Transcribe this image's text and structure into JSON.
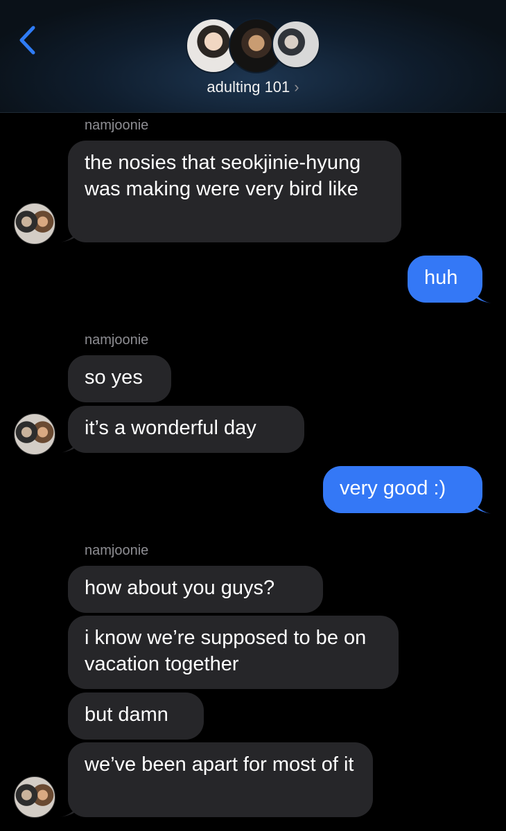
{
  "header": {
    "title": "adulting 101",
    "chevron": "›",
    "back_icon": "chevron-left-icon"
  },
  "messages": [
    {
      "sender": "namjoonie",
      "text": "the nosies that seokjinie-hyung was making were very bird like"
    },
    {
      "text": "huh"
    },
    {
      "sender": "namjoonie",
      "text": "so yes"
    },
    {
      "text": "it’s a wonderful day"
    },
    {
      "text": "very good :)"
    },
    {
      "sender": "namjoonie",
      "text": "how about you guys?"
    },
    {
      "text": "i know we’re supposed to be on vacation together"
    },
    {
      "text": "but damn"
    },
    {
      "text": "we’ve been apart for most of it"
    }
  ],
  "colors": {
    "incoming": "#262629",
    "outgoing": "#3478f6",
    "accent": "#2f7cf6"
  }
}
